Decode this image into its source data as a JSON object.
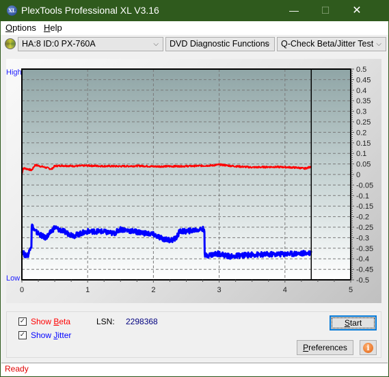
{
  "window": {
    "title": "PlexTools Professional XL V3.16",
    "icon_label": "XL",
    "controls": {
      "minimize": "—",
      "maximize": "☐",
      "close": "✕"
    }
  },
  "menu": {
    "items": [
      {
        "label": "Options",
        "accel": "O"
      },
      {
        "label": "Help",
        "accel": "H"
      }
    ]
  },
  "toolbar": {
    "drive": "HA:8 ID:0  PX-760A",
    "function": "DVD Diagnostic Functions",
    "test": "Q-Check Beta/Jitter Test",
    "chevron": "⌵"
  },
  "chart_data": {
    "type": "line",
    "title": "",
    "xlabel": "",
    "ylabel_left_high": "High",
    "ylabel_left_low": "Low",
    "xlim": [
      0,
      5
    ],
    "ylim": [
      -0.5,
      0.5
    ],
    "x_ticks": [
      0,
      1,
      2,
      3,
      4,
      5
    ],
    "y_ticks": [
      0.5,
      0.45,
      0.4,
      0.35,
      0.3,
      0.25,
      0.2,
      0.15,
      0.1,
      0.05,
      0,
      -0.05,
      -0.1,
      -0.15,
      -0.2,
      -0.25,
      -0.3,
      -0.35,
      -0.4,
      -0.45,
      -0.5
    ],
    "grid": true,
    "end_marker_x": 4.4,
    "series": [
      {
        "name": "Beta",
        "color": "#ff0000",
        "x": [
          0.0,
          0.02,
          0.1,
          0.15,
          0.2,
          0.3,
          0.4,
          0.45,
          0.5,
          0.6,
          0.8,
          1.0,
          1.2,
          1.5,
          1.8,
          2.0,
          2.3,
          2.6,
          2.9,
          3.0,
          3.2,
          3.5,
          3.8,
          4.0,
          4.2,
          4.3,
          4.38,
          4.4
        ],
        "y": [
          0.0,
          0.03,
          0.025,
          0.02,
          0.045,
          0.038,
          0.03,
          0.025,
          0.04,
          0.042,
          0.04,
          0.042,
          0.04,
          0.039,
          0.041,
          0.038,
          0.039,
          0.04,
          0.043,
          0.047,
          0.04,
          0.034,
          0.036,
          0.035,
          0.032,
          0.028,
          0.035,
          0.04
        ]
      },
      {
        "name": "Jitter",
        "color": "#0000ff",
        "x": [
          0.0,
          0.05,
          0.1,
          0.13,
          0.15,
          0.2,
          0.3,
          0.35,
          0.4,
          0.45,
          0.5,
          0.55,
          0.6,
          0.7,
          0.8,
          0.9,
          1.0,
          1.2,
          1.4,
          1.5,
          1.7,
          1.9,
          2.0,
          2.1,
          2.2,
          2.3,
          2.35,
          2.4,
          2.5,
          2.6,
          2.7,
          2.77,
          2.78,
          2.9,
          3.0,
          3.1,
          3.2,
          3.3,
          3.5,
          3.7,
          3.9,
          4.1,
          4.3,
          4.4
        ],
        "y": [
          -0.36,
          -0.385,
          -0.38,
          -0.34,
          -0.24,
          -0.27,
          -0.29,
          -0.3,
          -0.29,
          -0.27,
          -0.25,
          -0.26,
          -0.265,
          -0.28,
          -0.29,
          -0.28,
          -0.27,
          -0.27,
          -0.28,
          -0.26,
          -0.27,
          -0.28,
          -0.285,
          -0.3,
          -0.31,
          -0.31,
          -0.3,
          -0.27,
          -0.27,
          -0.265,
          -0.26,
          -0.26,
          -0.385,
          -0.38,
          -0.375,
          -0.385,
          -0.39,
          -0.385,
          -0.38,
          -0.38,
          -0.378,
          -0.376,
          -0.374,
          -0.37
        ]
      }
    ]
  },
  "controls": {
    "show_beta": {
      "label": "Show ",
      "accel": "B",
      "rest": "eta",
      "checked": true,
      "color": "#ff0000"
    },
    "show_jitter": {
      "label": "Show ",
      "accel": "J",
      "rest": "itter",
      "checked": true,
      "color": "#0000ff"
    },
    "lsn_label": "LSN:",
    "lsn_value": "2298368",
    "start_button": {
      "accel": "S",
      "rest": "tart"
    },
    "preferences_button": {
      "accel": "P",
      "rest": "references"
    },
    "info_icon": "i",
    "check_glyph": "✓"
  },
  "status": {
    "text": "Ready"
  }
}
